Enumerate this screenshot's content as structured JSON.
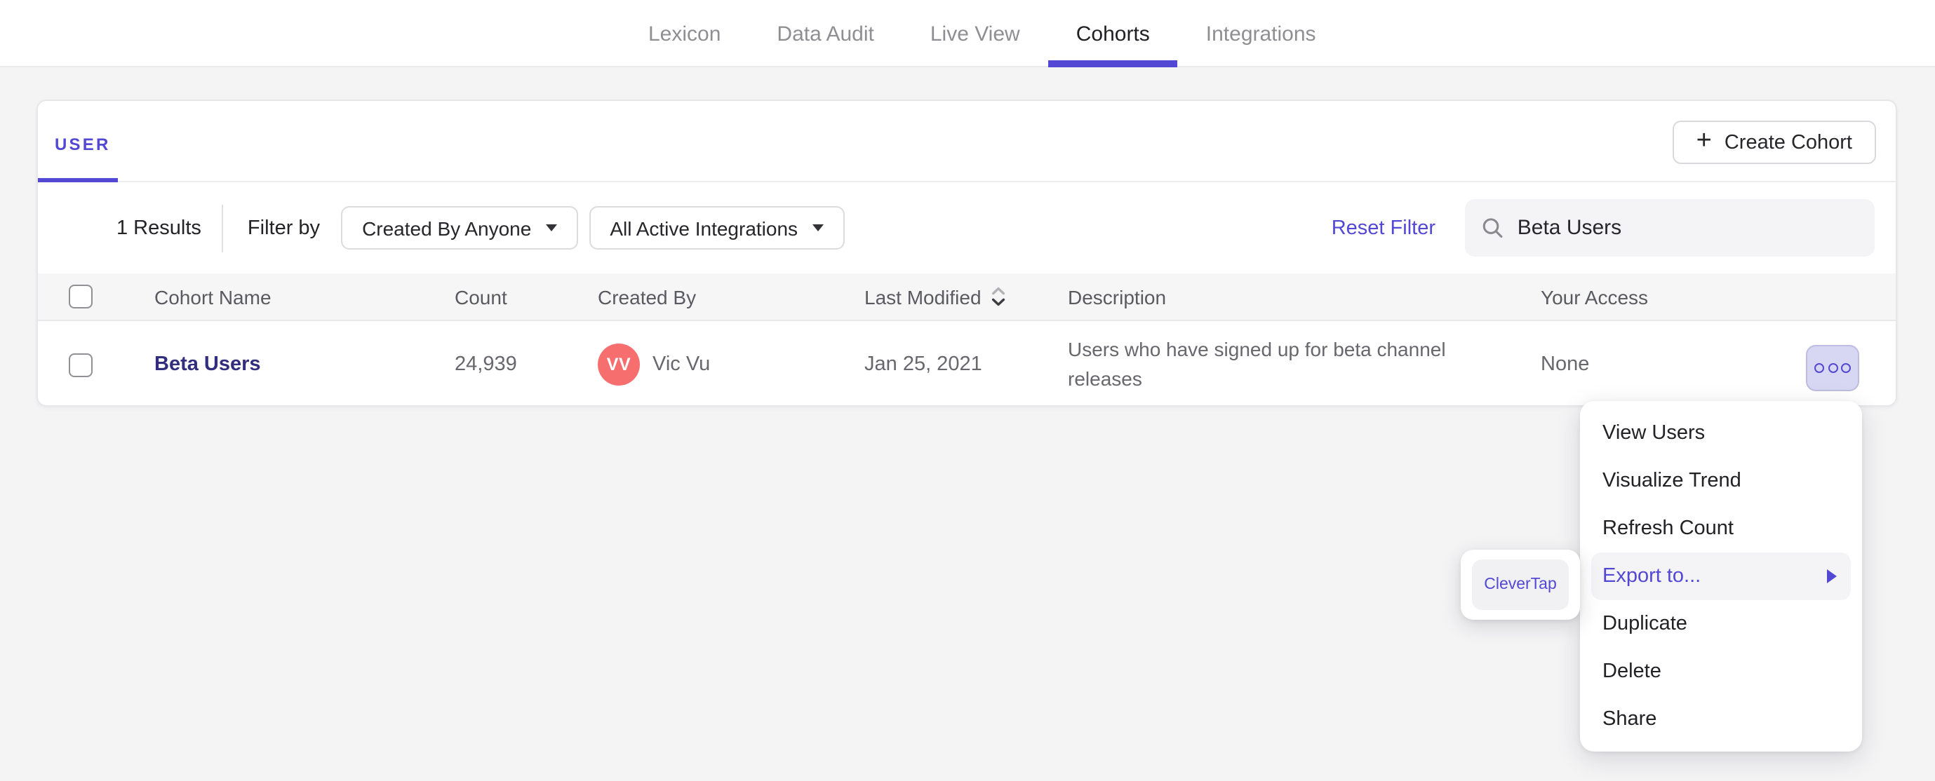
{
  "nav": {
    "items": [
      {
        "label": "Lexicon",
        "active": false
      },
      {
        "label": "Data Audit",
        "active": false
      },
      {
        "label": "Live View",
        "active": false
      },
      {
        "label": "Cohorts",
        "active": true
      },
      {
        "label": "Integrations",
        "active": false
      }
    ]
  },
  "cohorts_page": {
    "tab_label": "USER",
    "create_button_label": "Create Cohort",
    "filters": {
      "results_count": "1 Results",
      "filter_by_label": "Filter by",
      "created_by_filter": "Created By Anyone",
      "integrations_filter": "All Active Integrations",
      "reset_filter_label": "Reset Filter",
      "search_value": "Beta Users"
    },
    "table": {
      "columns": [
        "Cohort Name",
        "Count",
        "Created By",
        "Last Modified",
        "Description",
        "Your Access"
      ],
      "sorted_column": "Last Modified",
      "rows": [
        {
          "name": "Beta Users",
          "count": "24,939",
          "avatar_initials": "VV",
          "created_by": "Vic Vu",
          "last_modified": "Jan 25, 2021",
          "description": "Users who have signed up for beta channel releases",
          "your_access": "None"
        }
      ]
    }
  },
  "context_menu": {
    "items": [
      "View Users",
      "Visualize Trend",
      "Refresh Count",
      "Export to...",
      "Duplicate",
      "Delete",
      "Share"
    ],
    "highlighted_item": "Export to...",
    "export_submenu": {
      "items": [
        "CleverTap"
      ]
    }
  },
  "colors": {
    "accent": "#5348d4",
    "cohort_link": "#312e7d",
    "avatar_bg": "#f66e6e",
    "more_button_bg": "#d7d7f3"
  }
}
